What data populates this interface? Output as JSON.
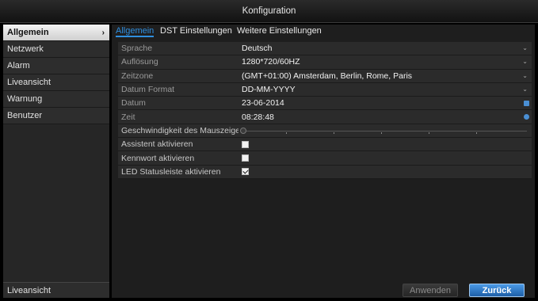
{
  "window": {
    "title": "Konfiguration"
  },
  "sidebar": {
    "items": [
      {
        "label": "Allgemein",
        "active": true
      },
      {
        "label": "Netzwerk"
      },
      {
        "label": "Alarm"
      },
      {
        "label": "Liveansicht"
      },
      {
        "label": "Warnung"
      },
      {
        "label": "Benutzer"
      }
    ],
    "bottom_label": "Liveansicht"
  },
  "tabs": [
    {
      "label": "Allgemein",
      "active": true
    },
    {
      "label": "DST Einstellungen"
    },
    {
      "label": "Weitere Einstellungen"
    }
  ],
  "settings": {
    "language": {
      "label": "Sprache",
      "value": "Deutsch"
    },
    "resolution": {
      "label": "Auflösung",
      "value": "1280*720/60HZ"
    },
    "timezone": {
      "label": "Zeitzone",
      "value": "(GMT+01:00) Amsterdam, Berlin, Rome, Paris"
    },
    "date_format": {
      "label": "Datum Format",
      "value": "DD-MM-YYYY"
    },
    "date": {
      "label": "Datum",
      "value": "23-06-2014"
    },
    "time": {
      "label": "Zeit",
      "value": "08:28:48"
    },
    "mouse_speed": {
      "label": "Geschwindigkeit des Mauszeigers",
      "level": 0
    },
    "wizard": {
      "label": "Assistent aktivieren",
      "checked": false
    },
    "password": {
      "label": "Kennwort aktivieren",
      "checked": false
    },
    "led": {
      "label": "LED Statusleiste aktivieren",
      "checked": true
    }
  },
  "buttons": {
    "apply": "Anwenden",
    "back": "Zurück"
  },
  "icons": {
    "sidebar_active": "chevron-right-icon",
    "dropdown": "chevron-down-icon",
    "date": "calendar-icon",
    "time": "clock-icon"
  },
  "colors": {
    "accent": "#2f8fe0",
    "primary_button": "#1d5fa8"
  }
}
